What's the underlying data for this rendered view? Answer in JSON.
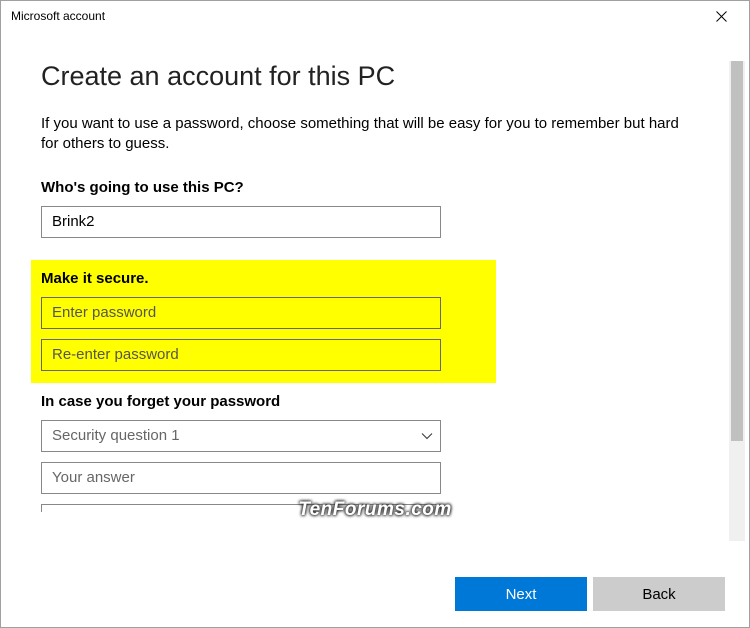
{
  "titlebar": {
    "title": "Microsoft account"
  },
  "heading": "Create an account for this PC",
  "description": "If you want to use a password, choose something that will be easy for you to remember but hard for others to guess.",
  "sections": {
    "username": {
      "label": "Who's going to use this PC?",
      "value": "Brink2"
    },
    "password": {
      "label": "Make it secure.",
      "enter_placeholder": "Enter password",
      "reenter_placeholder": "Re-enter password"
    },
    "security": {
      "label": "In case you forget your password",
      "question_placeholder": "Security question 1",
      "answer_placeholder": "Your answer"
    }
  },
  "buttons": {
    "next": "Next",
    "back": "Back"
  },
  "watermark": "TenForums.com"
}
